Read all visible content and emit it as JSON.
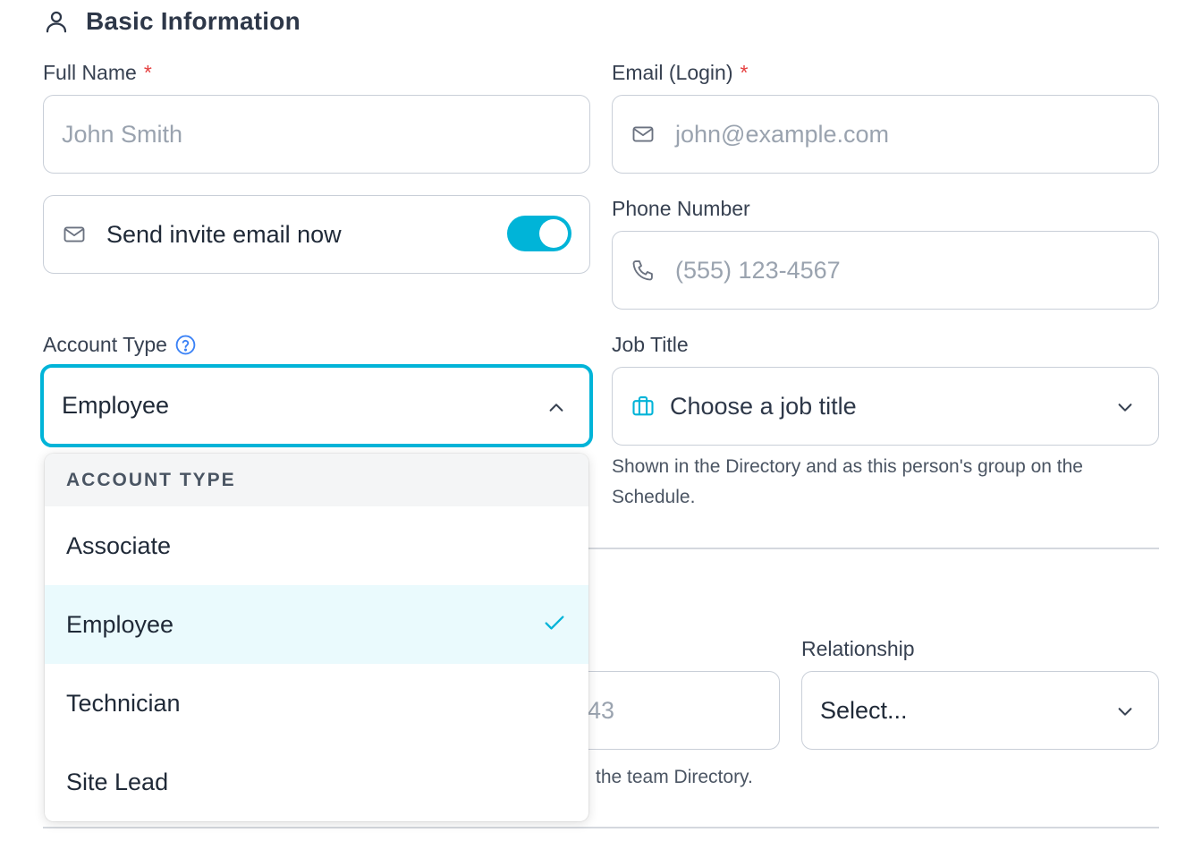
{
  "section": {
    "title": "Basic Information",
    "icon": "user-icon"
  },
  "full_name": {
    "label": "Full Name",
    "required_mark": "*",
    "placeholder": "John Smith"
  },
  "email": {
    "label": "Email (Login)",
    "required_mark": "*",
    "placeholder": "john@example.com",
    "icon": "mail-icon"
  },
  "invite": {
    "label": "Send invite email now",
    "icon": "mail-icon",
    "enabled": true
  },
  "phone": {
    "label": "Phone Number",
    "placeholder": "(555) 123-4567",
    "icon": "phone-icon"
  },
  "account_type": {
    "label": "Account Type",
    "help_icon": "help-circle-icon",
    "value": "Employee",
    "open": true,
    "menu_header": "ACCOUNT TYPE",
    "options": [
      "Associate",
      "Employee",
      "Technician",
      "Site Lead"
    ],
    "selected": "Employee"
  },
  "job_title": {
    "label": "Job Title",
    "placeholder": "Choose a job title",
    "icon": "briefcase-icon",
    "help": "Shown in the Directory and as this person's group on the Schedule."
  },
  "emergency": {
    "phone_partial": "43",
    "help_partial": "the team Directory.",
    "relationship_label": "Relationship",
    "relationship_value": "Select..."
  },
  "colors": {
    "accent": "#00b4d8",
    "required": "#e53e3e",
    "help_icon": "#3b82f6"
  }
}
